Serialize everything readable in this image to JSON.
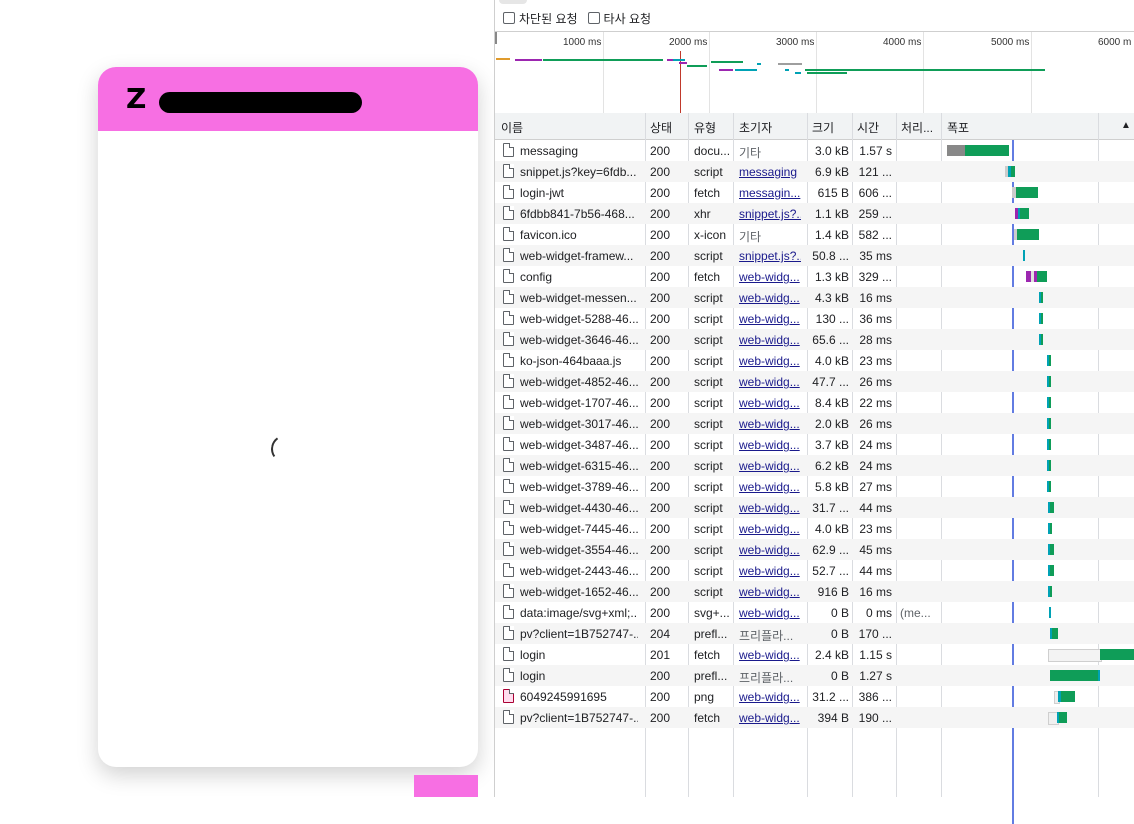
{
  "widget": {
    "logo": "Z",
    "header_color": "#f76fe3"
  },
  "filters": {
    "blocked": "차단된 요청",
    "third_party": "타사 요청"
  },
  "overview": {
    "ticks": [
      "1000 ms",
      "2000 ms",
      "3000 ms",
      "4000 ms",
      "5000 ms",
      "6000 m"
    ]
  },
  "columns": {
    "name": "이름",
    "status": "상태",
    "type": "유형",
    "initiator": "초기자",
    "size": "크기",
    "time": "시간",
    "processing": "처리...",
    "waterfall": "폭포",
    "sort_icon": "▲"
  },
  "requests": [
    {
      "name": "messaging",
      "status": "200",
      "type": "docu...",
      "initiator": "기타",
      "init_link": false,
      "size": "3.0 kB",
      "time": "1.57 s",
      "proc": "",
      "icon": "file-icon"
    },
    {
      "name": "snippet.js?key=6fdb...",
      "status": "200",
      "type": "script",
      "initiator": "messaging",
      "init_link": true,
      "size": "6.9 kB",
      "time": "121 ...",
      "proc": "",
      "icon": "file-icon"
    },
    {
      "name": "login-jwt",
      "status": "200",
      "type": "fetch",
      "initiator": "messagin...",
      "init_link": true,
      "size": "615 B",
      "time": "606 ...",
      "proc": "",
      "icon": "file-icon"
    },
    {
      "name": "6fdbb841-7b56-468...",
      "status": "200",
      "type": "xhr",
      "initiator": "snippet.js?...",
      "init_link": true,
      "size": "1.1 kB",
      "time": "259 ...",
      "proc": "",
      "icon": "file-icon"
    },
    {
      "name": "favicon.ico",
      "status": "200",
      "type": "x-icon",
      "initiator": "기타",
      "init_link": false,
      "size": "1.4 kB",
      "time": "582 ...",
      "proc": "",
      "icon": "file-icon"
    },
    {
      "name": "web-widget-framew...",
      "status": "200",
      "type": "script",
      "initiator": "snippet.js?...",
      "init_link": true,
      "size": "50.8 ...",
      "time": "35 ms",
      "proc": "",
      "icon": "file-icon"
    },
    {
      "name": "config",
      "status": "200",
      "type": "fetch",
      "initiator": "web-widg...",
      "init_link": true,
      "size": "1.3 kB",
      "time": "329 ...",
      "proc": "",
      "icon": "file-icon"
    },
    {
      "name": "web-widget-messen...",
      "status": "200",
      "type": "script",
      "initiator": "web-widg...",
      "init_link": true,
      "size": "4.3 kB",
      "time": "16 ms",
      "proc": "",
      "icon": "file-icon"
    },
    {
      "name": "web-widget-5288-46...",
      "status": "200",
      "type": "script",
      "initiator": "web-widg...",
      "init_link": true,
      "size": "130 ...",
      "time": "36 ms",
      "proc": "",
      "icon": "file-icon"
    },
    {
      "name": "web-widget-3646-46...",
      "status": "200",
      "type": "script",
      "initiator": "web-widg...",
      "init_link": true,
      "size": "65.6 ...",
      "time": "28 ms",
      "proc": "",
      "icon": "file-icon"
    },
    {
      "name": "ko-json-464baaa.js",
      "status": "200",
      "type": "script",
      "initiator": "web-widg...",
      "init_link": true,
      "size": "4.0 kB",
      "time": "23 ms",
      "proc": "",
      "icon": "file-icon"
    },
    {
      "name": "web-widget-4852-46...",
      "status": "200",
      "type": "script",
      "initiator": "web-widg...",
      "init_link": true,
      "size": "47.7 ...",
      "time": "26 ms",
      "proc": "",
      "icon": "file-icon"
    },
    {
      "name": "web-widget-1707-46...",
      "status": "200",
      "type": "script",
      "initiator": "web-widg...",
      "init_link": true,
      "size": "8.4 kB",
      "time": "22 ms",
      "proc": "",
      "icon": "file-icon"
    },
    {
      "name": "web-widget-3017-46...",
      "status": "200",
      "type": "script",
      "initiator": "web-widg...",
      "init_link": true,
      "size": "2.0 kB",
      "time": "26 ms",
      "proc": "",
      "icon": "file-icon"
    },
    {
      "name": "web-widget-3487-46...",
      "status": "200",
      "type": "script",
      "initiator": "web-widg...",
      "init_link": true,
      "size": "3.7 kB",
      "time": "24 ms",
      "proc": "",
      "icon": "file-icon"
    },
    {
      "name": "web-widget-6315-46...",
      "status": "200",
      "type": "script",
      "initiator": "web-widg...",
      "init_link": true,
      "size": "6.2 kB",
      "time": "24 ms",
      "proc": "",
      "icon": "file-icon"
    },
    {
      "name": "web-widget-3789-46...",
      "status": "200",
      "type": "script",
      "initiator": "web-widg...",
      "init_link": true,
      "size": "5.8 kB",
      "time": "27 ms",
      "proc": "",
      "icon": "file-icon"
    },
    {
      "name": "web-widget-4430-46...",
      "status": "200",
      "type": "script",
      "initiator": "web-widg...",
      "init_link": true,
      "size": "31.7 ...",
      "time": "44 ms",
      "proc": "",
      "icon": "file-icon"
    },
    {
      "name": "web-widget-7445-46...",
      "status": "200",
      "type": "script",
      "initiator": "web-widg...",
      "init_link": true,
      "size": "4.0 kB",
      "time": "23 ms",
      "proc": "",
      "icon": "file-icon"
    },
    {
      "name": "web-widget-3554-46...",
      "status": "200",
      "type": "script",
      "initiator": "web-widg...",
      "init_link": true,
      "size": "62.9 ...",
      "time": "45 ms",
      "proc": "",
      "icon": "file-icon"
    },
    {
      "name": "web-widget-2443-46...",
      "status": "200",
      "type": "script",
      "initiator": "web-widg...",
      "init_link": true,
      "size": "52.7 ...",
      "time": "44 ms",
      "proc": "",
      "icon": "file-icon"
    },
    {
      "name": "web-widget-1652-46...",
      "status": "200",
      "type": "script",
      "initiator": "web-widg...",
      "init_link": true,
      "size": "916 B",
      "time": "16 ms",
      "proc": "",
      "icon": "file-icon"
    },
    {
      "name": "data:image/svg+xml;...",
      "status": "200",
      "type": "svg+...",
      "initiator": "web-widg...",
      "init_link": true,
      "size": "0 B",
      "time": "0 ms",
      "proc": "(me...",
      "icon": "file-icon"
    },
    {
      "name": "pv?client=1B752747-...",
      "status": "204",
      "type": "prefl...",
      "initiator": "프리플라...",
      "init_link": false,
      "size": "0 B",
      "time": "170 ...",
      "proc": "",
      "icon": "file-icon"
    },
    {
      "name": "login",
      "status": "201",
      "type": "fetch",
      "initiator": "web-widg...",
      "init_link": true,
      "size": "2.4 kB",
      "time": "1.15 s",
      "proc": "",
      "icon": "file-icon"
    },
    {
      "name": "login",
      "status": "200",
      "type": "prefl...",
      "initiator": "프리플라...",
      "init_link": false,
      "size": "0 B",
      "time": "1.27 s",
      "proc": "",
      "icon": "file-icon"
    },
    {
      "name": "6049245991695",
      "status": "200",
      "type": "png",
      "initiator": "web-widg...",
      "init_link": true,
      "size": "31.2 ...",
      "time": "386 ...",
      "proc": "",
      "icon": "image-icon"
    },
    {
      "name": "pv?client=1B752747-...",
      "status": "200",
      "type": "fetch",
      "initiator": "web-widg...",
      "init_link": true,
      "size": "394 B",
      "time": "190 ...",
      "proc": "",
      "icon": "file-icon"
    }
  ],
  "colors": {
    "green": "#0f9d58",
    "teal": "#00a2b5",
    "purple": "#9c27b0",
    "grey": "#9e9e9e",
    "load_line": "#3b5bdb"
  }
}
